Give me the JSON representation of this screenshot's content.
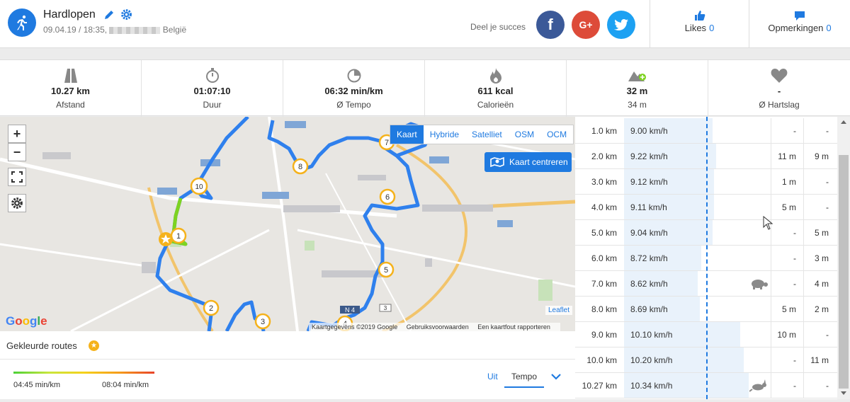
{
  "activity": {
    "title": "Hardlopen",
    "date": "09.04.19 / 18:35,",
    "location": "België"
  },
  "share": {
    "label": "Deel je succes",
    "facebook": "f",
    "googleplus": "G+"
  },
  "likes": {
    "label": "Likes",
    "count": "0"
  },
  "comments": {
    "label": "Opmerkingen",
    "count": "0"
  },
  "stats": [
    {
      "icon": "road-icon",
      "value": "10.27 km",
      "label": "Afstand"
    },
    {
      "icon": "stopwatch-icon",
      "value": "01:07:10",
      "label": "Duur"
    },
    {
      "icon": "pace-icon",
      "value": "06:32 min/km",
      "label": "Ø Tempo"
    },
    {
      "icon": "flame-icon",
      "value": "611 kcal",
      "label": "Calorieën"
    },
    {
      "icon": "elevation-icon",
      "value": "32 m",
      "label": "34 m"
    },
    {
      "icon": "heart-icon",
      "value": "-",
      "label": "Ø Hartslag"
    }
  ],
  "map": {
    "layers": [
      "Kaart",
      "Hybride",
      "Satelliet",
      "OSM",
      "OCM"
    ],
    "active_layer": "Kaart",
    "center_button": "Kaart centreren",
    "zoom_in": "+",
    "zoom_out": "−",
    "google": "Google",
    "leaflet": "Leaflet",
    "attribution": [
      "Kaartgegevens ©2019 Google",
      "Gebruiksvoorwaarden",
      "Een kaartfout rapporteren"
    ],
    "markers": [
      "1",
      "2",
      "3",
      "4",
      "5",
      "6",
      "7",
      "8",
      "10"
    ],
    "road_label": "N 4",
    "road_label_2": "3"
  },
  "routes": {
    "title": "Gekleurde routes",
    "legend_min": "04:45 min/km",
    "legend_max": "08:04 min/km",
    "mode_off": "Uit",
    "mode_active": "Tempo"
  },
  "splits": [
    {
      "km": "1.0 km",
      "speed": "9.00 km/h",
      "fill": 0.71,
      "icon": "",
      "c1": "-",
      "c2": "-"
    },
    {
      "km": "2.0 km",
      "speed": "9.22 km/h",
      "fill": 0.74,
      "icon": "",
      "c1": "11 m",
      "c2": "9 m"
    },
    {
      "km": "3.0 km",
      "speed": "9.12 km/h",
      "fill": 0.72,
      "icon": "",
      "c1": "1 m",
      "c2": "-"
    },
    {
      "km": "4.0 km",
      "speed": "9.11 km/h",
      "fill": 0.72,
      "icon": "",
      "c1": "5 m",
      "c2": "-"
    },
    {
      "km": "5.0 km",
      "speed": "9.04 km/h",
      "fill": 0.71,
      "icon": "",
      "c1": "-",
      "c2": "5 m"
    },
    {
      "km": "6.0 km",
      "speed": "8.72 km/h",
      "fill": 0.62,
      "icon": "",
      "c1": "-",
      "c2": "3 m"
    },
    {
      "km": "7.0 km",
      "speed": "8.62 km/h",
      "fill": 0.59,
      "icon": "turtle-icon",
      "c1": "-",
      "c2": "4 m"
    },
    {
      "km": "8.0 km",
      "speed": "8.69 km/h",
      "fill": 0.61,
      "icon": "",
      "c1": "5 m",
      "c2": "2 m"
    },
    {
      "km": "9.0 km",
      "speed": "10.10 km/h",
      "fill": 0.93,
      "icon": "",
      "c1": "10 m",
      "c2": "-"
    },
    {
      "km": "10.0 km",
      "speed": "10.20 km/h",
      "fill": 0.96,
      "icon": "",
      "c1": "-",
      "c2": "11 m"
    },
    {
      "km": "10.27 km",
      "speed": "10.34 km/h",
      "fill": 1.0,
      "icon": "rabbit-icon",
      "c1": "-",
      "c2": "-"
    }
  ],
  "colors": {
    "accent": "#1f7ae0",
    "route": "#2f80ed",
    "route_fast": "#7ed321",
    "marker_ring": "#f5b21b"
  }
}
